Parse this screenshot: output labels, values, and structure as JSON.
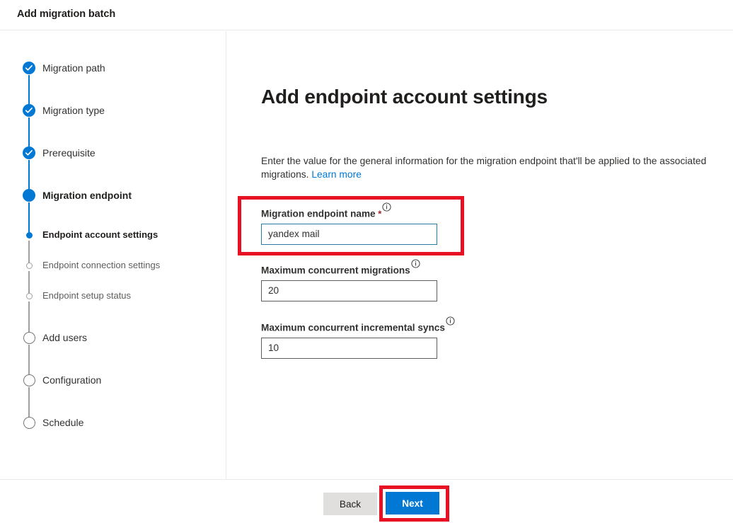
{
  "window": {
    "title": "Add migration batch"
  },
  "wizard": {
    "steps": [
      {
        "label": "Migration path",
        "state": "done",
        "marker": "check-circle-icon"
      },
      {
        "label": "Migration type",
        "state": "done",
        "marker": "check-circle-icon"
      },
      {
        "label": "Prerequisite",
        "state": "done",
        "marker": "check-circle-icon"
      },
      {
        "label": "Migration endpoint",
        "state": "current",
        "marker": "filled-circle-icon"
      },
      {
        "label": "Endpoint account settings",
        "state": "sub-current",
        "marker": "small-filled-dot-icon"
      },
      {
        "label": "Endpoint connection settings",
        "state": "sub-todo",
        "marker": "small-hollow-dot-icon"
      },
      {
        "label": "Endpoint setup status",
        "state": "sub-todo",
        "marker": "small-hollow-dot-icon"
      },
      {
        "label": "Add users",
        "state": "todo",
        "marker": "hollow-circle-icon"
      },
      {
        "label": "Configuration",
        "state": "todo",
        "marker": "hollow-circle-icon"
      },
      {
        "label": "Schedule",
        "state": "todo",
        "marker": "hollow-circle-icon"
      }
    ]
  },
  "main": {
    "heading": "Add endpoint account settings",
    "description_text": "Enter the value for the general information for the migration endpoint that'll be applied to the associated migrations. ",
    "learn_more_label": "Learn more",
    "fields": [
      {
        "label": "Migration endpoint name",
        "required": true,
        "value": "yandex mail",
        "placeholder": "",
        "focused": true,
        "info_icon": "info-circle-icon"
      },
      {
        "label": "Maximum concurrent migrations",
        "required": false,
        "value": "20",
        "placeholder": "",
        "focused": false,
        "info_icon": "info-circle-icon"
      },
      {
        "label": "Maximum concurrent incremental syncs",
        "required": false,
        "value": "10",
        "placeholder": "",
        "focused": false,
        "info_icon": "info-circle-icon"
      }
    ]
  },
  "footer": {
    "back_label": "Back",
    "next_label": "Next"
  },
  "annotations": {
    "highlight_color": "#e81123",
    "boxes": [
      {
        "name": "migration-endpoint-name-highlight"
      },
      {
        "name": "next-button-highlight"
      }
    ]
  },
  "colors": {
    "accent": "#0078d4",
    "link": "#0078d4",
    "required_star": "#a4262c",
    "focus_border": "#2b7ca3",
    "back_button_bg": "#e1dfdd"
  }
}
